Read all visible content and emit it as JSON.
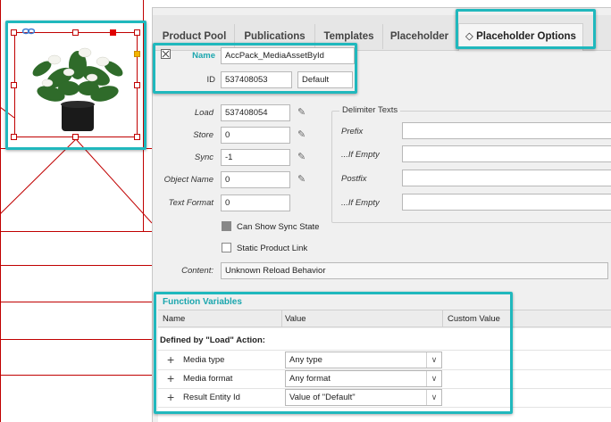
{
  "tabs": [
    {
      "label": "Product Pool"
    },
    {
      "label": "Publications"
    },
    {
      "label": "Templates"
    },
    {
      "label": "Placeholder"
    },
    {
      "label": "Placeholder Options"
    }
  ],
  "tab_active_prefix": "◇",
  "name_field": {
    "label": "Name",
    "value": "AccPack_MediaAssetById"
  },
  "id_field": {
    "label": "ID",
    "value": "537408053",
    "extra": "Default"
  },
  "fields": {
    "load": {
      "label": "Load",
      "value": "537408054"
    },
    "store": {
      "label": "Store",
      "value": "0"
    },
    "sync": {
      "label": "Sync",
      "value": "-1"
    },
    "object_name": {
      "label": "Object Name",
      "value": "0"
    },
    "text_format": {
      "label": "Text Format",
      "value": "0"
    }
  },
  "delimiter": {
    "title": "Delimiter Texts",
    "prefix": "Prefix",
    "prefix_empty": "...If Empty",
    "postfix": "Postfix",
    "postfix_empty": "...If Empty"
  },
  "checkboxes": {
    "can_show_sync": {
      "label": "Can Show Sync State",
      "checked": true
    },
    "static_link": {
      "label": "Static Product Link",
      "checked": false
    }
  },
  "content": {
    "label": "Content:",
    "value": "Unknown Reload Behavior"
  },
  "function_variables": {
    "title": "Function Variables",
    "columns": {
      "name": "Name",
      "value": "Value",
      "custom": "Custom Value"
    },
    "group": "Defined by \"Load\" Action:",
    "rows": [
      {
        "name": "Media type",
        "value": "Any type"
      },
      {
        "name": "Media format",
        "value": "Any format"
      },
      {
        "name": "Result Entity Id",
        "value": "Value of \"Default\""
      }
    ]
  },
  "colors": {
    "highlight": "#20b8bd",
    "frame": "#c00000",
    "accent_text": "#1ba6ae"
  }
}
